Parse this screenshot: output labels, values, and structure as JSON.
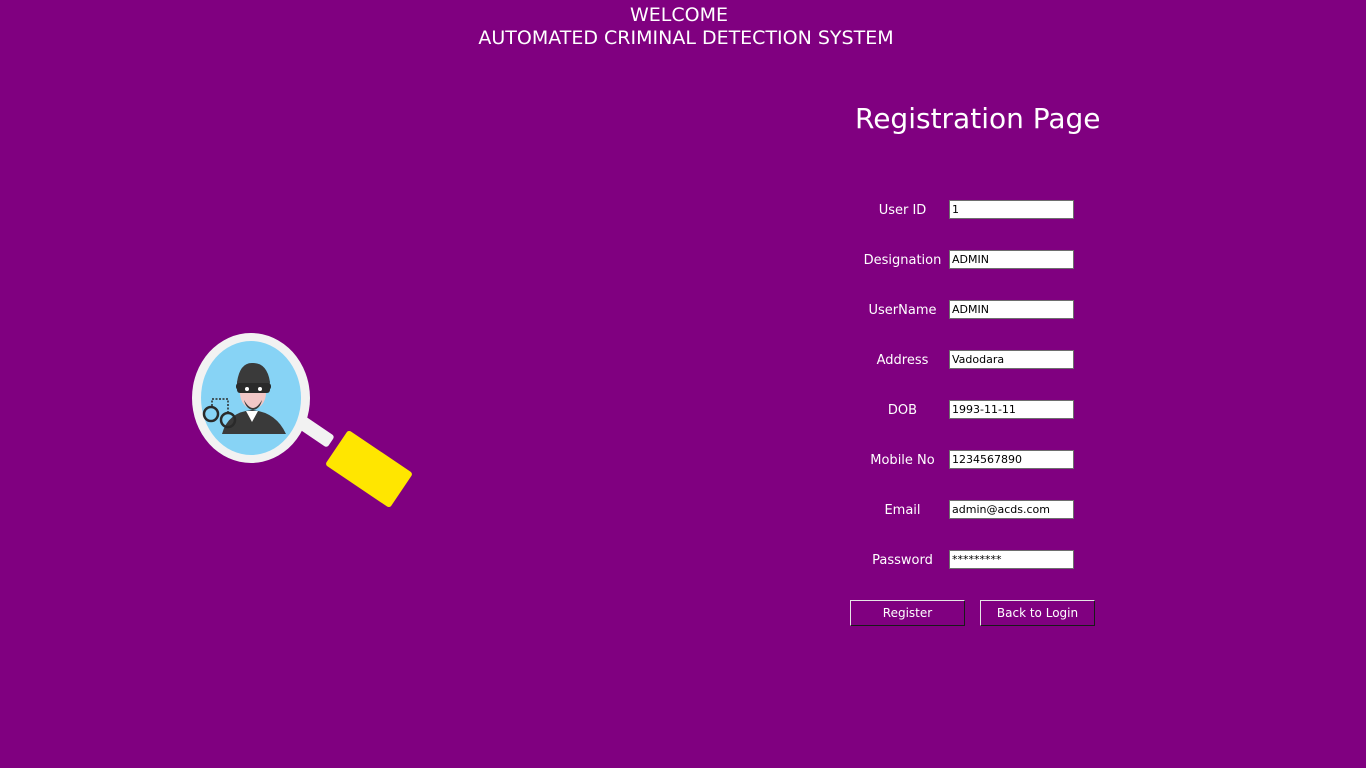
{
  "header": {
    "welcome": "WELCOME",
    "system_name": "AUTOMATED CRIMINAL DETECTION SYSTEM"
  },
  "page_title": "Registration Page",
  "form": {
    "fields": [
      {
        "label": "User ID",
        "value": "1"
      },
      {
        "label": "Designation",
        "value": "ADMIN"
      },
      {
        "label": "UserName",
        "value": "ADMIN"
      },
      {
        "label": "Address",
        "value": "Vadodara"
      },
      {
        "label": "DOB",
        "value": "1993-11-11"
      },
      {
        "label": "Mobile No",
        "value": "1234567890"
      },
      {
        "label": "Email",
        "value": "admin@acds.com"
      },
      {
        "label": "Password",
        "value": "*********"
      }
    ]
  },
  "buttons": {
    "register": "Register",
    "back_to_login": "Back to Login"
  },
  "logo": {
    "icon": "magnifier-criminal-icon"
  },
  "colors": {
    "background": "#800080",
    "text": "#ffffff",
    "magnifier_lens": "#87d3f5",
    "magnifier_handle": "#ffe600"
  }
}
